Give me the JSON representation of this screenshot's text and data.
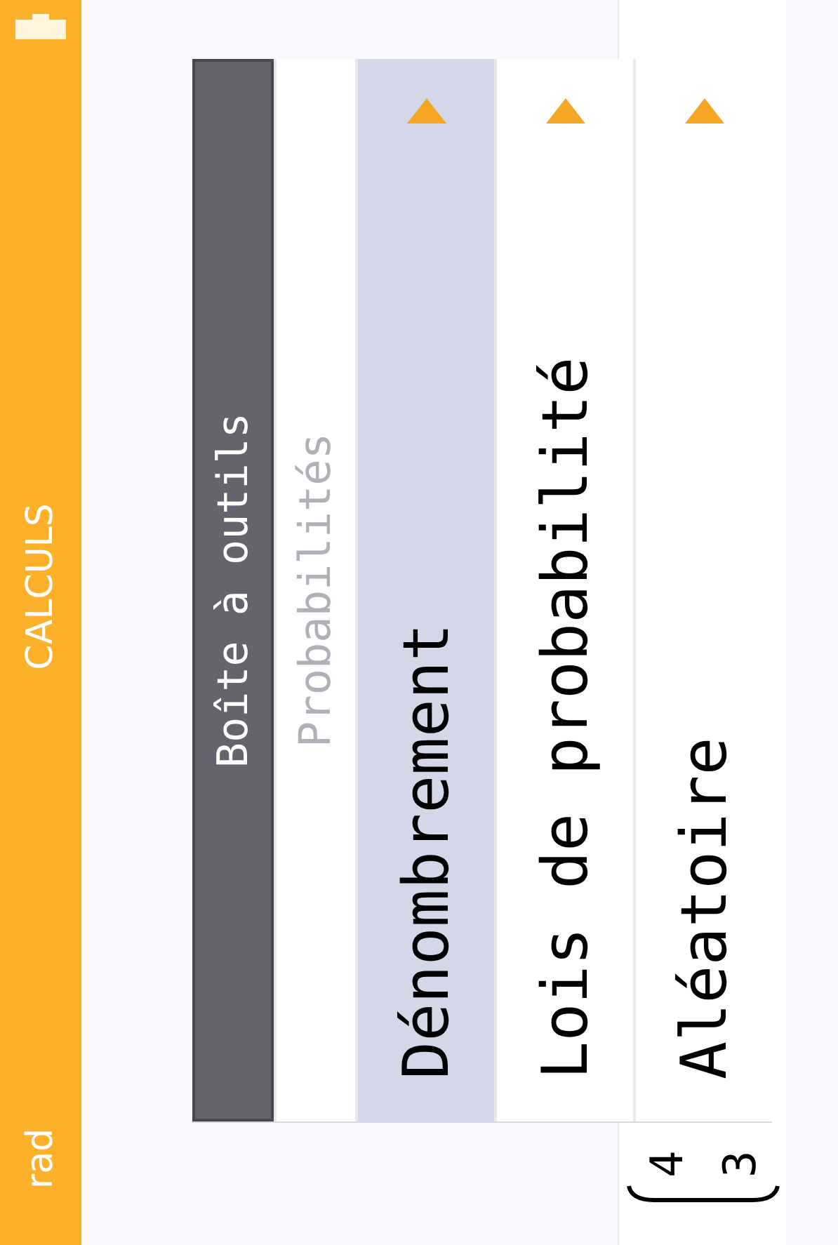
{
  "status_bar": {
    "angle_unit": "rad",
    "title": "CALCULS"
  },
  "history": {
    "matrix_entries": [
      "4",
      "3"
    ]
  },
  "toolbox": {
    "title": "Boîte à outils",
    "subtitle": "Probabilités",
    "items": [
      {
        "label": "Dénombrement",
        "selected": true
      },
      {
        "label": "Lois de probabilité",
        "selected": false
      },
      {
        "label": "Aléatoire",
        "selected": false
      }
    ]
  }
}
